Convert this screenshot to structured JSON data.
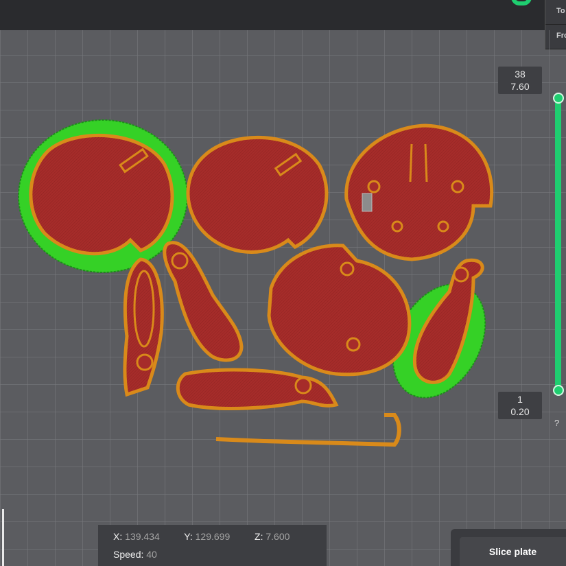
{
  "top_tabs": [
    "To",
    "Fro"
  ],
  "layer_slider": {
    "top": {
      "layer": "38",
      "height": "7.60"
    },
    "bottom": {
      "layer": "1",
      "height": "0.20"
    },
    "help": "?"
  },
  "coords": {
    "x_label": "X:",
    "x": "139.434",
    "y_label": "Y:",
    "y": "129.699",
    "z_label": "Z:",
    "z": "7.600",
    "speed_label": "Speed:",
    "speed": "40"
  },
  "actions": {
    "slice_plate": "Slice plate"
  },
  "colors": {
    "accent": "#1fce70",
    "part_fill": "#a62c2a",
    "part_wall": "#d98a1a",
    "brim": "#38d42a",
    "bed": "#5b5c60"
  }
}
